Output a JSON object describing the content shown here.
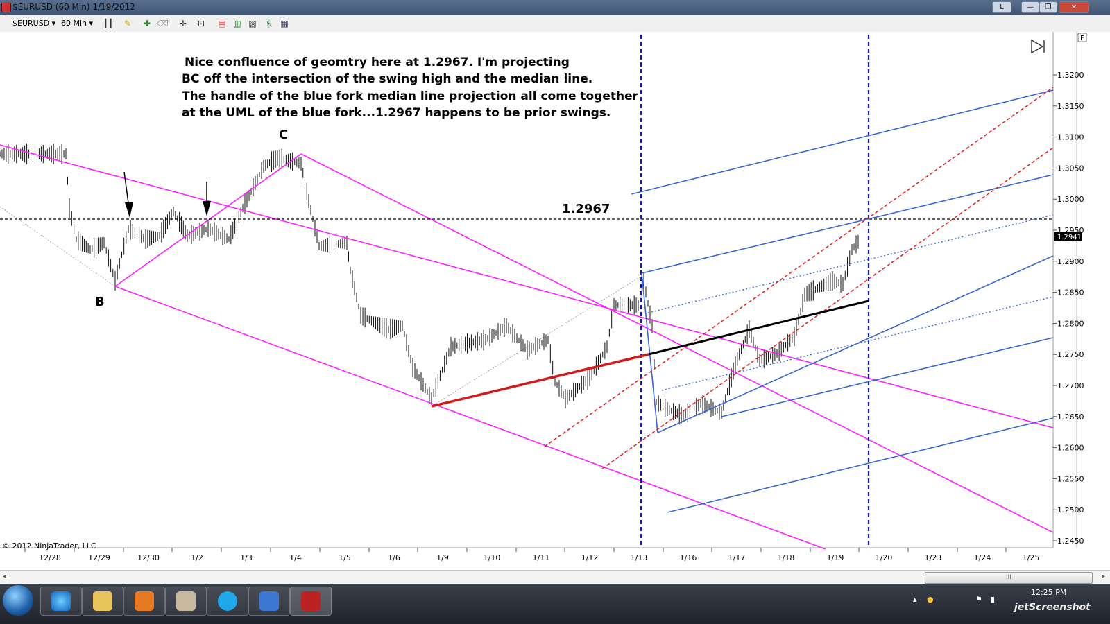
{
  "window": {
    "title": "$EURUSD (60 Min)  1/19/2012",
    "lang_indicator": "L",
    "minimize": "—",
    "restore": "❐",
    "close": "✕"
  },
  "toolbar": {
    "instrument": "$EURUSD",
    "interval": "60 Min",
    "icons": [
      "bars-icon",
      "pencil-icon",
      "pin-icon",
      "eraser-icon",
      "crosshair-icon",
      "zoom-icon",
      "strategy-icon",
      "chart-style-icon",
      "indicator-icon",
      "dollar-icon",
      "properties-icon"
    ]
  },
  "chart": {
    "annotation_lines": [
      " Nice confluence of geomtry here at 1.2967.  I'm projecting",
      "BC off the intersection of the swing high and the median line.",
      "The handle of the blue fork median line projection all come together",
      "at the UML of the blue fork...1.2967 happens to be prior swings."
    ],
    "point_label_b": "B",
    "point_label_c": "C",
    "level_label": "1.2967",
    "price_marker": "1.2941",
    "copyright": "© 2012 NinjaTrader, LLC",
    "panel_flag": "F",
    "y_ticks": [
      "1.3200",
      "1.3150",
      "1.3100",
      "1.3050",
      "1.3000",
      "1.2950",
      "1.2900",
      "1.2850",
      "1.2800",
      "1.2750",
      "1.2700",
      "1.2650",
      "1.2600",
      "1.2550",
      "1.2500",
      "1.2450"
    ],
    "x_ticks": [
      "12/28",
      "12/29",
      "12/30",
      "1/2",
      "1/3",
      "1/4",
      "1/5",
      "1/6",
      "1/9",
      "1/10",
      "1/11",
      "1/12",
      "1/13",
      "1/16",
      "1/17",
      "1/18",
      "1/19",
      "1/20",
      "1/23",
      "1/24",
      "1/25"
    ],
    "colors": {
      "magenta_fork": "#ff1fff",
      "blue_fork": "#3a66d0",
      "red_dashed": "#e02020",
      "vertical_dashed": "#0b17c8",
      "red_segment": "#d11a1a",
      "black_segment": "#000000"
    }
  },
  "scrollbar": {
    "grip": "III"
  },
  "taskbar": {
    "tray_time": "12:25 PM",
    "watermark": "jetScreenshot"
  }
}
